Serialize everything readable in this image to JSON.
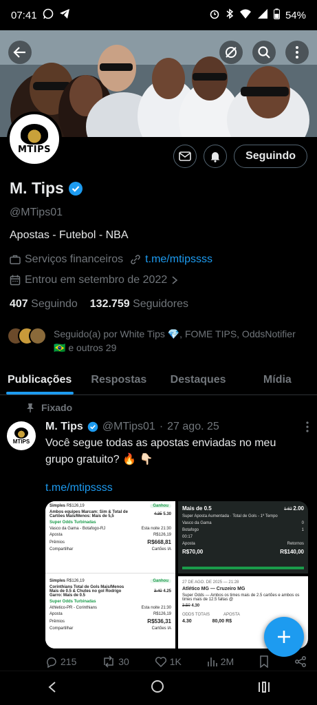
{
  "status_bar": {
    "time": "07:41",
    "battery": "54%"
  },
  "banner": {
    "description": "Real Madrid players celebrating"
  },
  "profile": {
    "logo_text": "MTIPS",
    "name": "M. Tips",
    "handle": "@MTips01",
    "bio": "Apostas - Futebol - NBA",
    "category": "Serviços financeiros",
    "link": "t.me/mtipssss",
    "joined": "Entrou em setembro de 2022",
    "following_count": "407",
    "following_label": "Seguindo",
    "followers_count": "132.759",
    "followers_label": "Seguidores",
    "follow_button": "Seguindo",
    "followed_by_line1": "Seguido(a) por White Tips 💎, FOME TIPS, OddsNotifier",
    "followed_by_line2": "🇧🇷 e outros 29",
    "verified_color": "#1d9bf0"
  },
  "tabs": [
    {
      "label": "Publicações",
      "active": true
    },
    {
      "label": "Respostas",
      "active": false
    },
    {
      "label": "Destaques",
      "active": false
    },
    {
      "label": "Mídia",
      "active": false
    }
  ],
  "post": {
    "pinned_label": "Fixado",
    "author_name": "M. Tips",
    "author_handle": "@MTips01",
    "separator": "·",
    "date": "27 ago. 25",
    "text": "Você segue todas as apostas enviadas no meu grupo gratuito? 🔥 👇🏻",
    "link": "t.me/mtipssss",
    "media": {
      "slip1": {
        "type": "Simples",
        "stake_top": "R$126,19",
        "status": "Ganhou",
        "market": "Ambos equipes Marcam: Sim & Total de Cartões Mais/Menos: Mais de 5,5",
        "odds_old": "4.35",
        "odds": "5.30",
        "boost": "Super Odds Turbinadas",
        "match": "Vasco da Gama - Botafogo-RJ",
        "time": "Esta noite 21:30",
        "stake_label": "Aposta",
        "stake": "R$126,19",
        "prize_label": "Prêmios",
        "prize": "R$668,81",
        "share": "Compartilhar",
        "cards": "Cartões IA"
      },
      "slip2": {
        "type": "Simples",
        "stake_top": "R$126,19",
        "status": "Ganhou",
        "market": "Corinthians Total de Gols Mais/Menos Mais de 0.5 & Chutes no gol Rodrigo Garro: Mais de 0.5",
        "odds_old": "3.40",
        "odds": "4.25",
        "boost": "Super Odds Turbinadas",
        "match": "Athletico-PR - Corinthians",
        "time": "Esta noite 21:30",
        "stake_label": "Aposta",
        "stake": "R$126,19",
        "prize_label": "Prêmios",
        "prize": "R$536,31",
        "share": "Compartilhar",
        "cards": "Cartões IA"
      },
      "slip3": {
        "market": "Mais de 0.5",
        "odds_old": "1.62",
        "odds": "2.00",
        "boost": "Super Aposta Aumentada",
        "sub": "Total de Gols - 1º Tempo",
        "team1": "Vasco da Gama",
        "score1": "0",
        "team2": "Botafogo",
        "score2": "1",
        "minute": "00:17",
        "stake_label": "Aposta",
        "stake": "R$70,00",
        "return_label": "Retornos",
        "return": "R$140,00"
      },
      "slip4": {
        "date": "27 DE AGO. DE 2025 — 21:28",
        "match": "Atlético MG — Cruzeiro MG",
        "desc": "Super Odds — Ambos os times mais de 2.5 cartões e ambos os times mais de 12.5 faltas @",
        "odds_old": "3.50",
        "odds": "4.30",
        "odds_label": "ODDS TOTAIS",
        "bet_label": "APOSTA",
        "bet": "80,00 R$"
      }
    },
    "actions": {
      "replies": "215",
      "reposts": "30",
      "likes": "1K",
      "views": "2M"
    }
  }
}
